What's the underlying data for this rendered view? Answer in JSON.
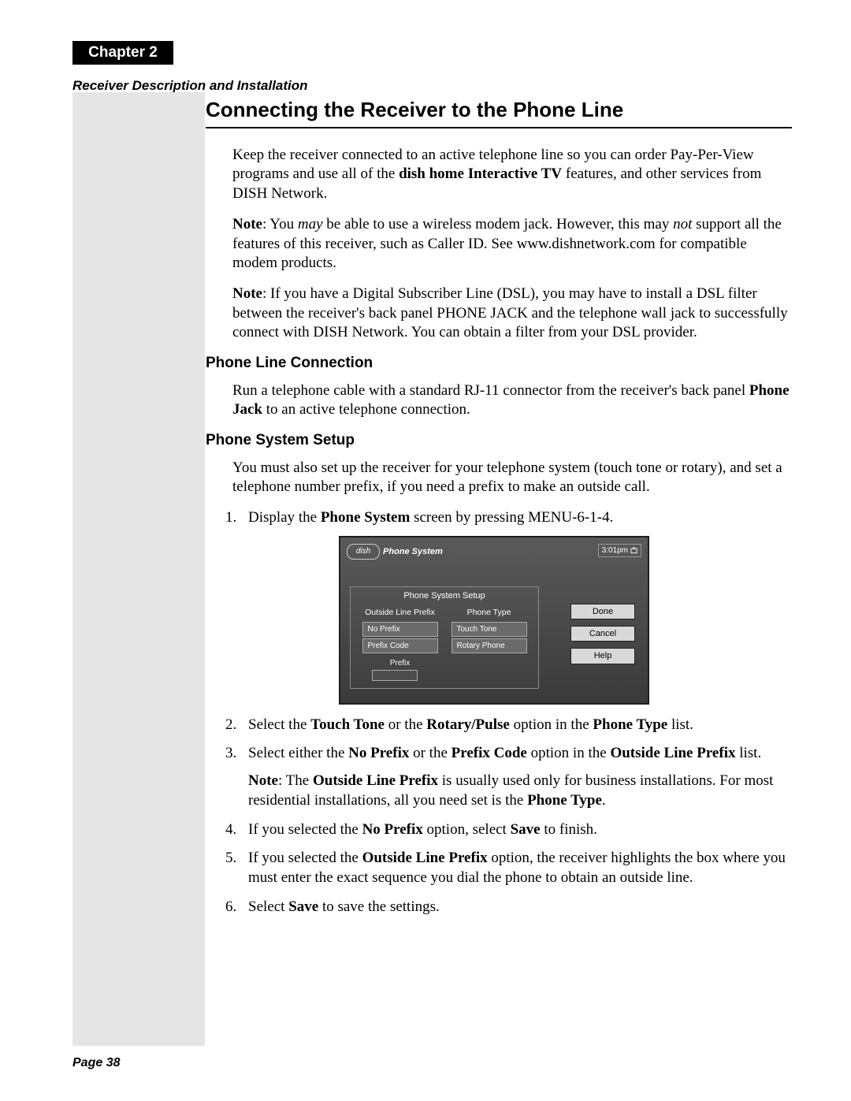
{
  "chapter_tab": "Chapter 2",
  "section_italic": "Receiver Description and Installation",
  "main_heading": "Connecting the Receiver to the Phone Line",
  "intro_p1_a": "Keep the receiver connected to an active telephone line so you can order Pay-Per-View programs and use all of the ",
  "intro_p1_bold": "dish home Interactive TV",
  "intro_p1_b": " features, and other services from DISH Network.",
  "note1_label": "Note",
  "note1_a": ": You ",
  "note1_em1": "may",
  "note1_b": " be able to use a wireless modem jack. However, this may ",
  "note1_em2": "not",
  "note1_c": " support all the features of this receiver, such as Caller ID. See www.dishnetwork.com for compatible modem products.",
  "note2_label": "Note",
  "note2_text": ": If you have a Digital Subscriber Line (DSL), you may have to install a DSL filter between the receiver's back panel PHONE JACK and the telephone wall jack to successfully connect with DISH Network. You can obtain a filter from your DSL provider.",
  "sub1": "Phone Line Connection",
  "sub1_p_a": "Run a telephone cable with a standard RJ-11 connector from the receiver's back panel ",
  "sub1_p_bold": "Phone Jack",
  "sub1_p_b": " to an active telephone connection.",
  "sub2": "Phone System Setup",
  "sub2_p1": "You must also set up the receiver for your telephone system (touch tone or rotary), and set a telephone number prefix, if you need a prefix to make an outside call.",
  "step1_a": "Display the ",
  "step1_bold": "Phone System",
  "step1_b": " screen by pressing MENU-6-1-4.",
  "step2_a": "Select the ",
  "step2_b1": "Touch Tone",
  "step2_b": " or the ",
  "step2_b2": "Rotary/Pulse",
  "step2_c": " option in the ",
  "step2_b3": "Phone Type",
  "step2_d": " list.",
  "step3_a": "Select either the ",
  "step3_b1": "No Prefix",
  "step3_b": " or the ",
  "step3_b2": "Prefix Code",
  "step3_c": " option in the ",
  "step3_b3": "Outside Line Prefix",
  "step3_d": " list.",
  "note3_label": "Note",
  "note3_a": ": The ",
  "note3_b1": "Outside Line Prefix",
  "note3_b": " is usually used only for business installations. For most residential installations, all you need set is the ",
  "note3_b2": "Phone Type",
  "note3_c": ".",
  "step4_a": "If you selected the ",
  "step4_b1": "No Prefix",
  "step4_b": " option, select ",
  "step4_b2": "Save",
  "step4_c": " to finish.",
  "step5_a": "If you selected the ",
  "step5_b1": "Outside Line Prefix",
  "step5_b": " option, the receiver highlights the box where you must enter the exact sequence you dial the phone to obtain an outside line.",
  "step6_a": "Select ",
  "step6_b1": "Save",
  "step6_b": " to save the settings.",
  "footer": "Page 38",
  "tv": {
    "logo": "dish",
    "title": "Phone System",
    "time": "3:01pm",
    "panel_title": "Phone System Setup",
    "col1_head": "Outside Line Prefix",
    "col2_head": "Phone Type",
    "opt_noprefix": "No Prefix",
    "opt_prefixcode": "Prefix Code",
    "opt_touchtone": "Touch Tone",
    "opt_rotary": "Rotary Phone",
    "prefix_label": "Prefix",
    "btn_done": "Done",
    "btn_cancel": "Cancel",
    "btn_help": "Help"
  }
}
